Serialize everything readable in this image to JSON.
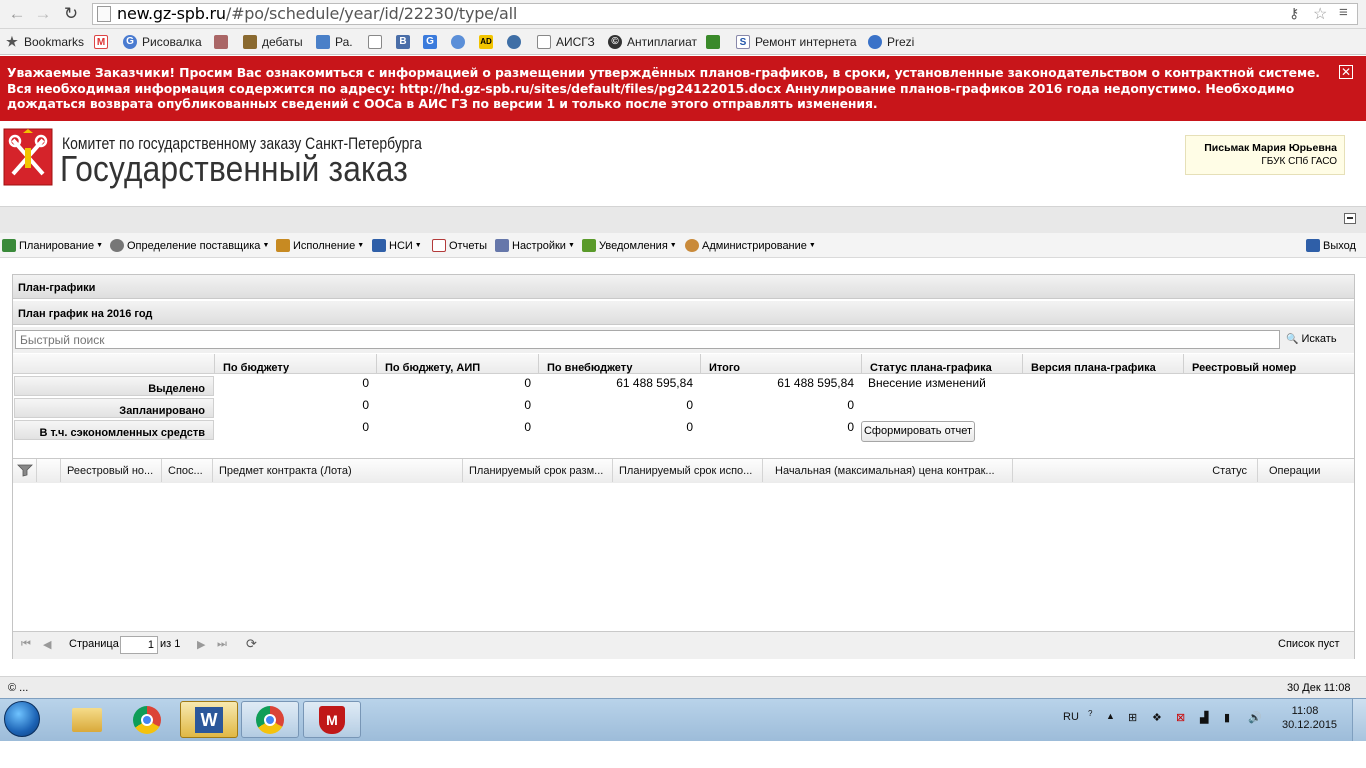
{
  "browser": {
    "url_host": "new.gz-spb.ru",
    "url_path": "/#po/schedule/year/id/22230/type/all",
    "bookmarks": [
      {
        "label": "Bookmarks",
        "icon": "star-icon"
      },
      {
        "label": "",
        "icon": "gmail-icon"
      },
      {
        "label": "Рисовалка",
        "icon": "google-icon"
      },
      {
        "label": "",
        "icon": "photo-icon"
      },
      {
        "label": "дебаты",
        "icon": "folder-icon"
      },
      {
        "label": "Ра.",
        "icon": "paint-icon"
      },
      {
        "label": "",
        "icon": "page-icon"
      },
      {
        "label": "",
        "icon": "vk-icon"
      },
      {
        "label": "",
        "icon": "translate-icon"
      },
      {
        "label": "",
        "icon": "globe-icon"
      },
      {
        "label": "",
        "icon": "ad-icon"
      },
      {
        "label": "",
        "icon": "cloud-icon"
      },
      {
        "label": "АИСГЗ",
        "icon": "page-icon"
      },
      {
        "label": "Антиплагиат",
        "icon": "antiplagiat-icon"
      },
      {
        "label": "",
        "icon": "calc-icon"
      },
      {
        "label": "Ремонт интернета",
        "icon": "s-icon"
      },
      {
        "label": "Prezi",
        "icon": "prezi-icon"
      }
    ]
  },
  "alert": {
    "text": "Уважаемые Заказчики! Просим Вас ознакомиться с информацией о размещении утверждённых планов-графиков, в сроки, установленные законодательством о контрактной системе. Вся необходимая информация содержится по адресу: http://hd.gz-spb.ru/sites/default/files/pg24122015.docx Аннулирование планов-графиков 2016 года недопустимо. Необходимо дождаться возврата опубликованных сведений с ООСа в АИС ГЗ по версии 1 и только после этого отправлять изменения.",
    "close": "✕"
  },
  "header": {
    "org": "Комитет по государственному заказу Санкт-Петербурга",
    "title": "Государственный заказ",
    "user_name": "Письмак Мария Юрьевна",
    "user_org": "ГБУК СПб ГАСО"
  },
  "menu": {
    "items": [
      {
        "label": "Планирование",
        "icon": "planning-icon",
        "color": "#3a8a3a",
        "dropdown": true
      },
      {
        "label": "Определение поставщика",
        "icon": "gears-icon",
        "color": "#777777",
        "dropdown": true
      },
      {
        "label": "Исполнение",
        "icon": "execution-icon",
        "color": "#c78a22",
        "dropdown": true
      },
      {
        "label": "НСИ",
        "icon": "book-icon",
        "color": "#2f5fa8",
        "dropdown": true
      },
      {
        "label": "Отчеты",
        "icon": "report-icon",
        "color": "#b33a3a",
        "dropdown": false
      },
      {
        "label": "Настройки",
        "icon": "wrench-icon",
        "color": "#6677aa",
        "dropdown": true
      },
      {
        "label": "Уведомления",
        "icon": "notify-icon",
        "color": "#5a9a2a",
        "dropdown": true
      },
      {
        "label": "Администрирование",
        "icon": "user-icon",
        "color": "#c98a3a",
        "dropdown": true
      }
    ],
    "exit": "Выход"
  },
  "panel": {
    "title": "План-графики",
    "subtitle": "План график на 2016 год",
    "search_placeholder": "Быстрый поиск",
    "search_button": "Искать"
  },
  "summary": {
    "columns": [
      "По бюджету",
      "По бюджету, АИП",
      "По внебюджету",
      "Итого",
      "Статус плана-графика",
      "Версия плана-графика",
      "Реестровый номер"
    ],
    "rows": [
      {
        "label": "Выделено",
        "values": [
          "0",
          "0",
          "61 488 595,84",
          "61 488 595,84"
        ],
        "status": "Внесение изменений"
      },
      {
        "label": "Запланировано",
        "values": [
          "0",
          "0",
          "0",
          "0"
        ],
        "status": ""
      },
      {
        "label": "В т.ч. сэкономленных средств",
        "values": [
          "0",
          "0",
          "0",
          "0"
        ],
        "status": ""
      }
    ],
    "report_button": "Сформировать отчет"
  },
  "grid": {
    "columns": [
      "Реестровый но...",
      "Спос...",
      "Предмет контракта (Лота)",
      "Планируемый срок разм...",
      "Планируемый срок испо...",
      "Начальная (максимальная) цена контрак...",
      "Статус",
      "Операции"
    ],
    "pager": {
      "page_label": "Страница",
      "page_value": "1",
      "of_label": "из 1",
      "empty_text": "Список пуст"
    }
  },
  "footer": {
    "left": "© ...",
    "right": "30 Дек 11:08"
  },
  "taskbar": {
    "lang": "RU",
    "time": "11:08",
    "date": "30.12.2015"
  }
}
